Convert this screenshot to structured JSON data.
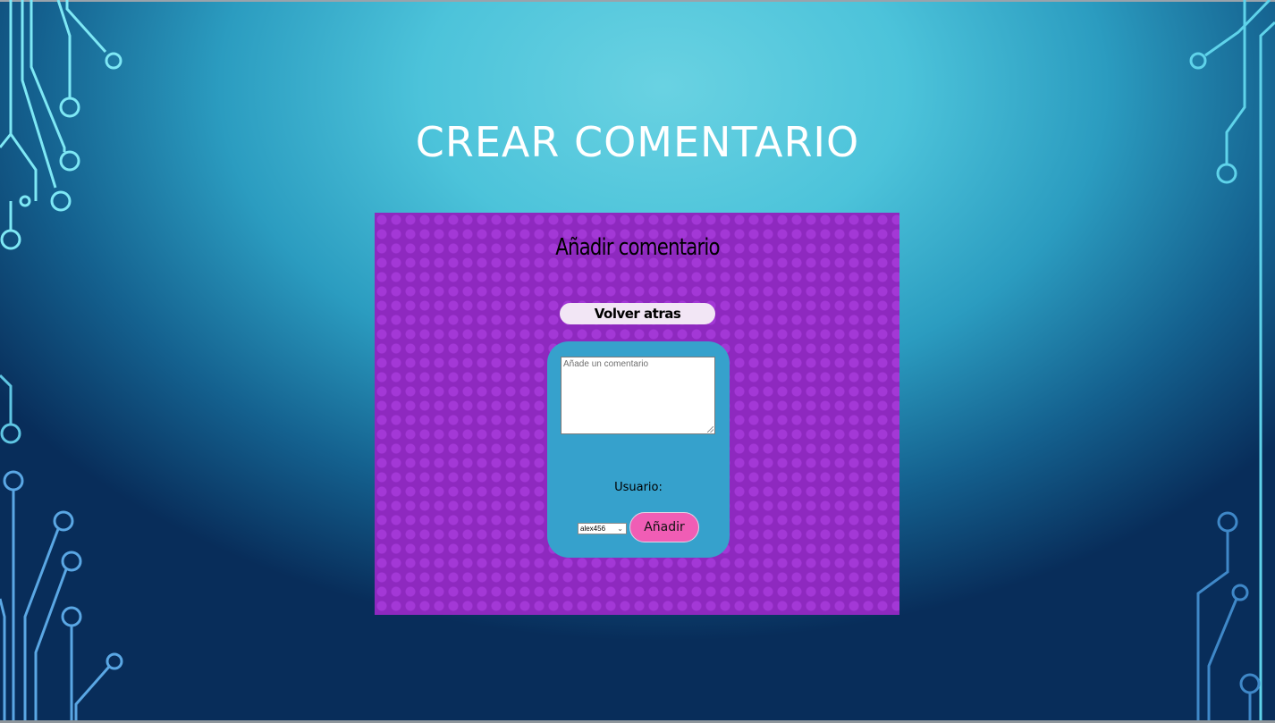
{
  "slide": {
    "title": "CREAR COMENTARIO"
  },
  "panel": {
    "title": "Añadir comentario",
    "back_label": "Volver atras",
    "comment_placeholder": "Añade un comentario",
    "comment_value": "",
    "user_label": "Usuario:",
    "user_selected": "alex456",
    "submit_label": "Añadir"
  },
  "colors": {
    "panel_bg": "#8e29bf",
    "form_bg": "#36a1cc",
    "submit_bg": "#f05db5",
    "back_bg": "#f2e6f5"
  }
}
